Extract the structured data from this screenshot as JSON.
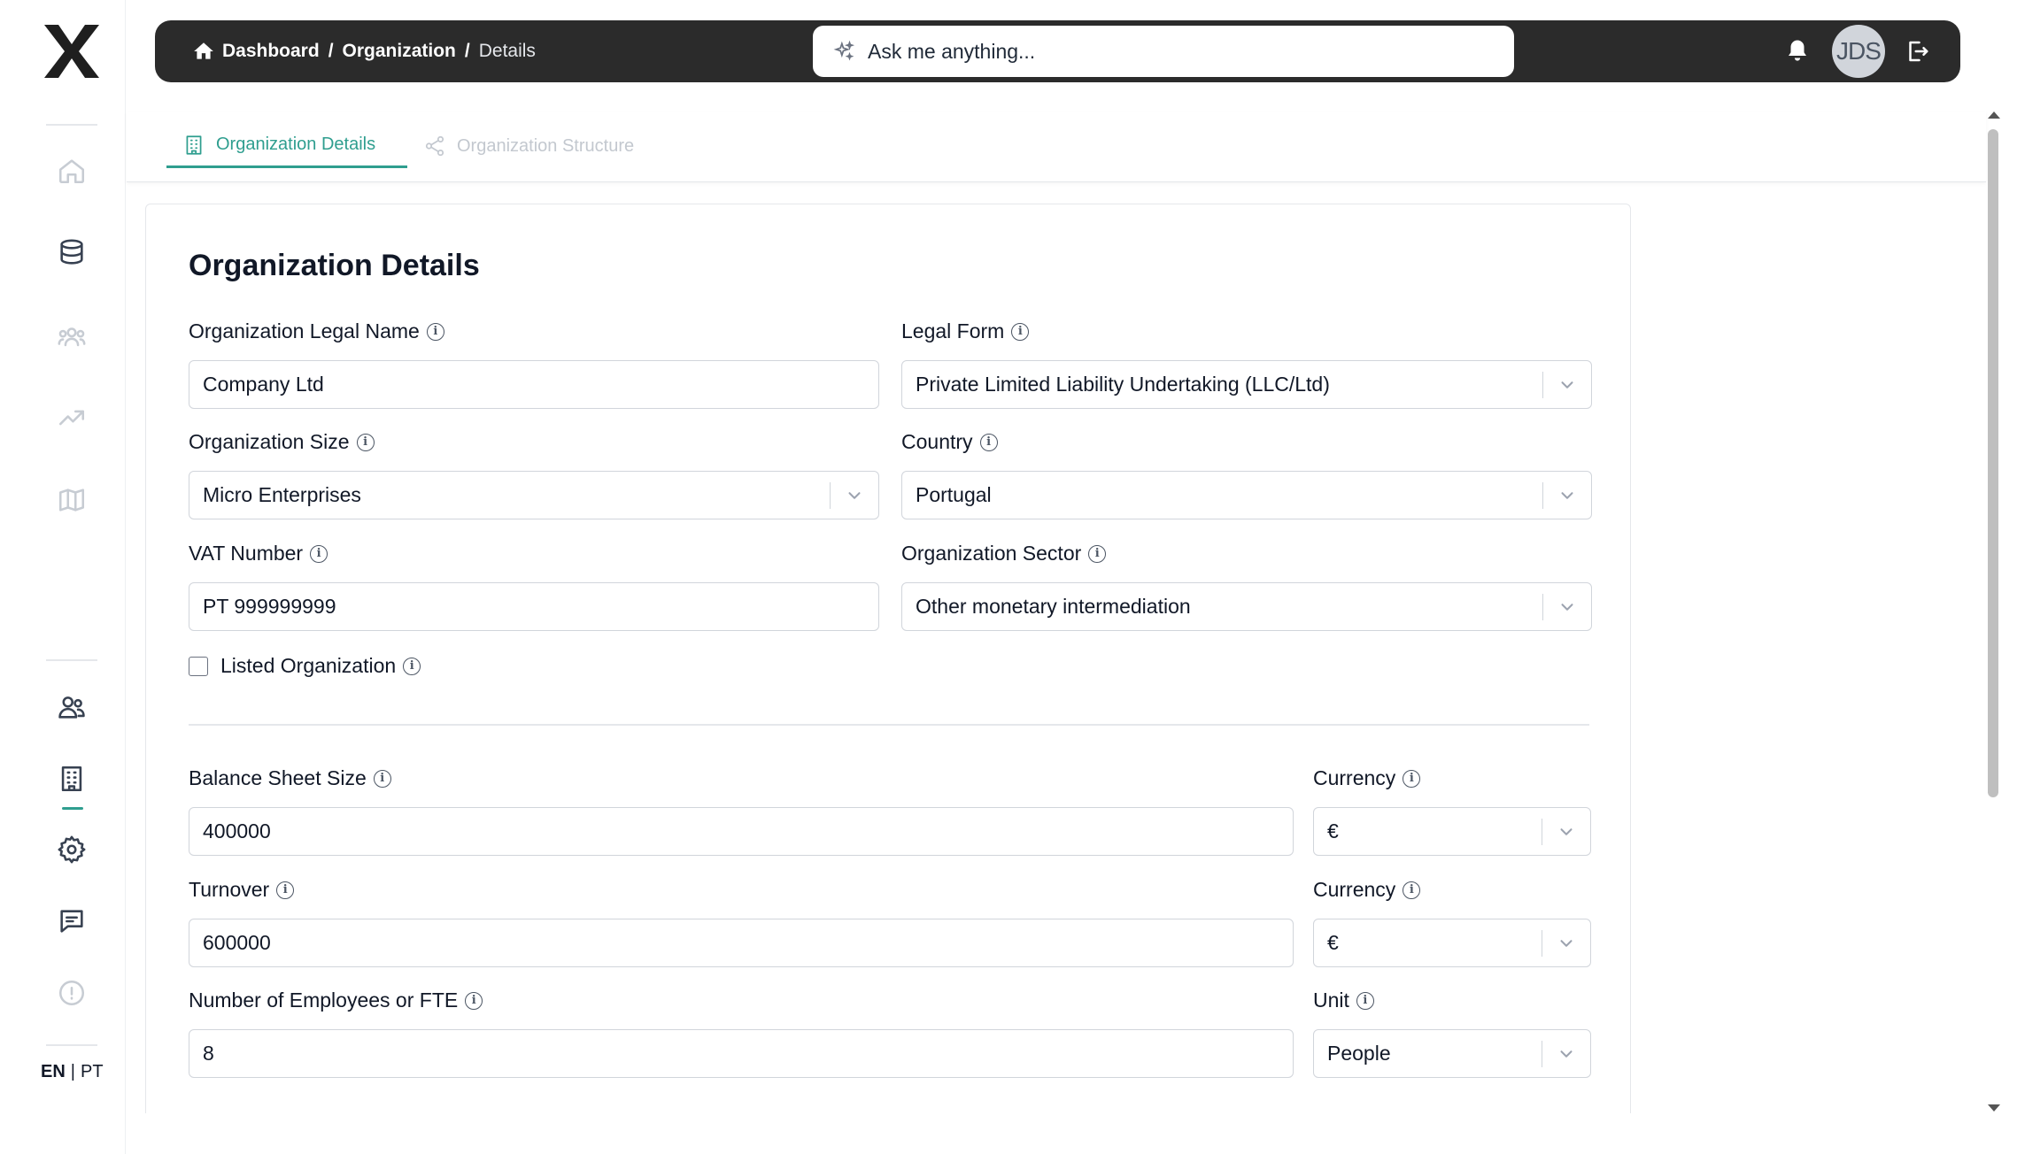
{
  "breadcrumb": {
    "items": [
      "Dashboard",
      "Organization"
    ],
    "current": "Details"
  },
  "assistant": {
    "placeholder": "Ask me anything..."
  },
  "user": {
    "initials": "JDS"
  },
  "language": {
    "en": "EN",
    "separator": "|",
    "pt": "PT"
  },
  "tabs": [
    {
      "label": "Organization Details",
      "icon": "building-icon",
      "active": true
    },
    {
      "label": "Organization Structure",
      "icon": "share-nodes-icon",
      "active": false
    }
  ],
  "form": {
    "title": "Organization Details",
    "legal_name": {
      "label": "Organization Legal Name",
      "value": "Company Ltd"
    },
    "legal_form": {
      "label": "Legal Form",
      "value": "Private Limited Liability Undertaking (LLC/Ltd)"
    },
    "size": {
      "label": "Organization Size",
      "value": "Micro Enterprises"
    },
    "country": {
      "label": "Country",
      "value": "Portugal"
    },
    "vat": {
      "label": "VAT Number",
      "value": "PT 999999999"
    },
    "sector": {
      "label": "Organization Sector",
      "value": "Other monetary intermediation"
    },
    "listed": {
      "label": "Listed Organization",
      "checked": false
    },
    "balance_sheet": {
      "label": "Balance Sheet Size",
      "value": "400000"
    },
    "balance_currency": {
      "label": "Currency",
      "value": "€"
    },
    "turnover": {
      "label": "Turnover",
      "value": "600000"
    },
    "turnover_currency": {
      "label": "Currency",
      "value": "€"
    },
    "employees": {
      "label": "Number of Employees or FTE",
      "value": "8"
    },
    "employees_unit": {
      "label": "Unit",
      "value": "People"
    }
  },
  "colors": {
    "accent": "#2f9e8f",
    "topbar": "#2b2b2b",
    "border": "#d1d5db"
  }
}
